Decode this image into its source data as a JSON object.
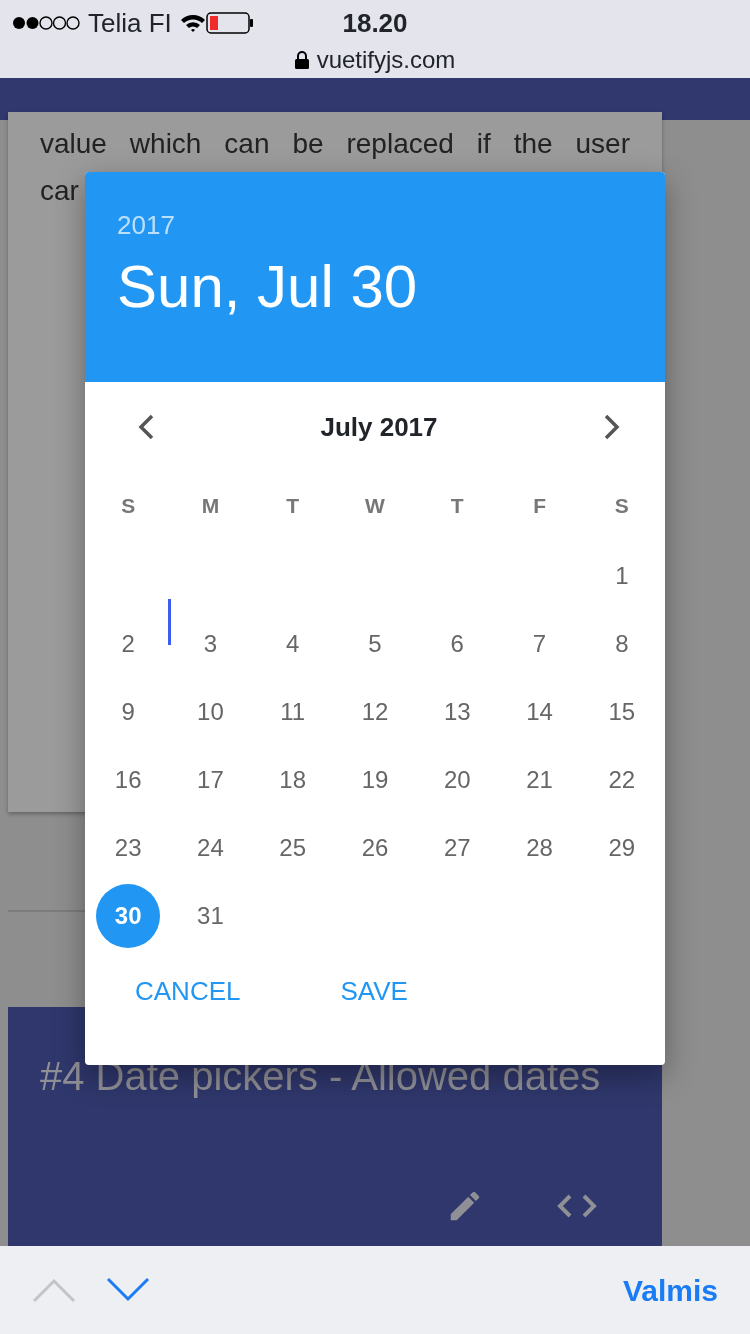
{
  "status_bar": {
    "carrier": "Telia FI",
    "time": "18.20",
    "url": "vuetifyjs.com"
  },
  "background_card": {
    "lines": [
      "value which can be replaced if the user",
      "car"
    ]
  },
  "example_card": {
    "title": "#4 Date pickers - Allowed dates"
  },
  "date_picker": {
    "year": "2017",
    "date": "Sun, Jul 30",
    "month": "July 2017",
    "weekdays": [
      "S",
      "M",
      "T",
      "W",
      "T",
      "F",
      "S"
    ],
    "weeks": [
      {
        "right_aligned": true,
        "days": [
          {
            "day": "1",
            "selected": false
          }
        ]
      },
      {
        "days": [
          {
            "day": "2",
            "selected": false
          },
          {
            "day": "3",
            "selected": false
          },
          {
            "day": "4",
            "selected": false
          },
          {
            "day": "5",
            "selected": false
          },
          {
            "day": "6",
            "selected": false
          },
          {
            "day": "7",
            "selected": false
          },
          {
            "day": "8",
            "selected": false
          }
        ]
      },
      {
        "days": [
          {
            "day": "9",
            "selected": false
          },
          {
            "day": "10",
            "selected": false
          },
          {
            "day": "11",
            "selected": false
          },
          {
            "day": "12",
            "selected": false
          },
          {
            "day": "13",
            "selected": false
          },
          {
            "day": "14",
            "selected": false
          },
          {
            "day": "15",
            "selected": false
          }
        ]
      },
      {
        "days": [
          {
            "day": "16",
            "selected": false
          },
          {
            "day": "17",
            "selected": false
          },
          {
            "day": "18",
            "selected": false
          },
          {
            "day": "19",
            "selected": false
          },
          {
            "day": "20",
            "selected": false
          },
          {
            "day": "21",
            "selected": false
          },
          {
            "day": "22",
            "selected": false
          }
        ]
      },
      {
        "days": [
          {
            "day": "23",
            "selected": false
          },
          {
            "day": "24",
            "selected": false
          },
          {
            "day": "25",
            "selected": false
          },
          {
            "day": "26",
            "selected": false
          },
          {
            "day": "27",
            "selected": false
          },
          {
            "day": "28",
            "selected": false
          },
          {
            "day": "29",
            "selected": false
          }
        ]
      },
      {
        "right_aligned": false,
        "days": [
          {
            "day": "30",
            "selected": true
          },
          {
            "day": "31",
            "selected": false
          }
        ]
      }
    ],
    "actions": [
      "CANCEL",
      "SAVE"
    ]
  },
  "keyboard_toolbar": {
    "previous_enabled": false,
    "next_enabled": true,
    "done": "Valmis"
  }
}
